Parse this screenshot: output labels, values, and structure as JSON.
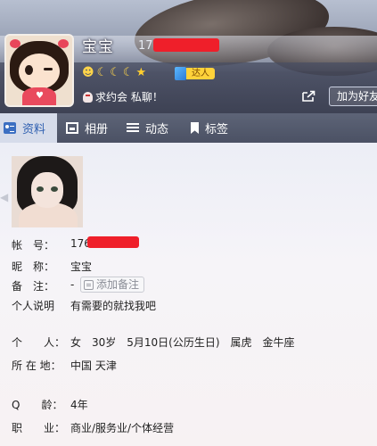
{
  "header": {
    "nickname": "宝宝",
    "qq_number": "176",
    "level_icons": [
      "sun-icon",
      "moon-icon",
      "moon-icon",
      "moon-icon",
      "star-icon"
    ],
    "badge": "达人",
    "tagline": "求约会 私聊！",
    "add_friend_label": "加为好友"
  },
  "tabs": [
    {
      "label": "资料",
      "icon": "profile-card-icon",
      "active": true
    },
    {
      "label": "相册",
      "icon": "photo-album-icon",
      "active": false
    },
    {
      "label": "动态",
      "icon": "feed-list-icon",
      "active": false
    },
    {
      "label": "标签",
      "icon": "bookmark-icon",
      "active": false
    }
  ],
  "profile": {
    "account": {
      "label": "帐　号：",
      "value": "176"
    },
    "nickname": {
      "label": "昵　称：",
      "value": "宝宝"
    },
    "remark": {
      "label": "备　注：",
      "value": "-",
      "button": "添加备注"
    },
    "description": {
      "label": "个人说明",
      "value": "有需要的就找我吧"
    },
    "personal": {
      "label": "个　　人：",
      "value": "女　30岁　5月10日(公历生日)　属虎　金牛座"
    },
    "location": {
      "label": "所 在 地：",
      "value": "中国 天津"
    },
    "qage": {
      "label": "Q　　龄：",
      "value": "4年"
    },
    "occupation": {
      "label": "职　　业：",
      "value": "商业/服务业/个体经营"
    }
  },
  "colors": {
    "accent": "#2e5fb0",
    "redaction": "#ef1f2a",
    "badge": "#ffd23a"
  }
}
